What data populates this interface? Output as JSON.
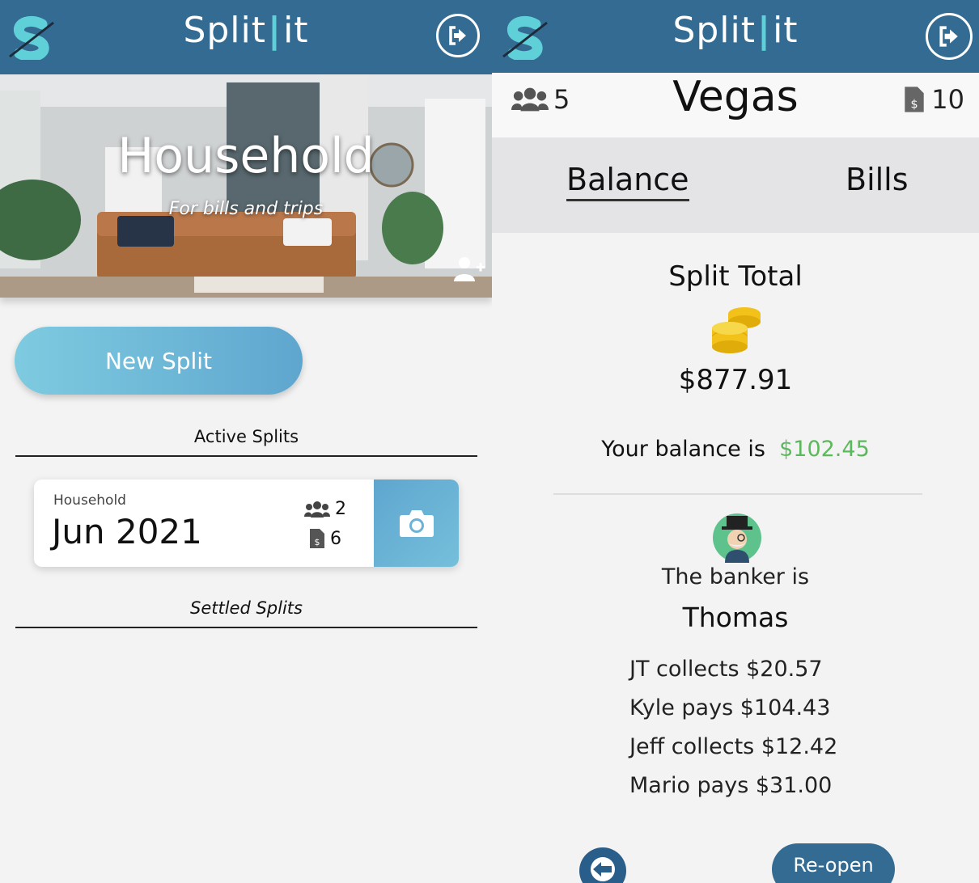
{
  "colors": {
    "header": "#336b93",
    "accent": "#5fd0d8",
    "button_gradient_start": "#7ecbe0",
    "button_gradient_end": "#5fa6cf",
    "positive": "#5cb85c"
  },
  "left": {
    "header": {
      "brand_left": "Split",
      "brand_sep": "|",
      "brand_right": "it",
      "logout_icon": "logout-icon"
    },
    "hero": {
      "title": "Household",
      "subtitle": "For bills and trips",
      "add_member_icon": "add-user-icon"
    },
    "new_split_label": "New Split",
    "active_heading": "Active Splits",
    "settled_heading": "Settled Splits",
    "active_splits": [
      {
        "group": "Household",
        "period": "Jun 2021",
        "members": "2",
        "bills": "6",
        "action_icon": "camera-icon"
      }
    ]
  },
  "right": {
    "header": {
      "brand_left": "Split",
      "brand_sep": "|",
      "brand_right": "it",
      "logout_icon": "logout-icon"
    },
    "split": {
      "title": "Vegas",
      "members": "5",
      "bills": "10"
    },
    "tabs": [
      {
        "label": "Balance",
        "active": true
      },
      {
        "label": "Bills",
        "active": false
      }
    ],
    "total_label": "Split Total",
    "total_amount": "$877.91",
    "balance_prefix": "Your balance is",
    "balance_amount": "$102.45",
    "banker_label": "The banker is",
    "banker_name": "Thomas",
    "settlements": [
      "JT collects $20.57",
      "Kyle pays $104.43",
      "Jeff collects $12.42",
      "Mario pays $31.00"
    ],
    "reopen_label": "Re-open",
    "back_icon": "back-arrow-icon"
  }
}
